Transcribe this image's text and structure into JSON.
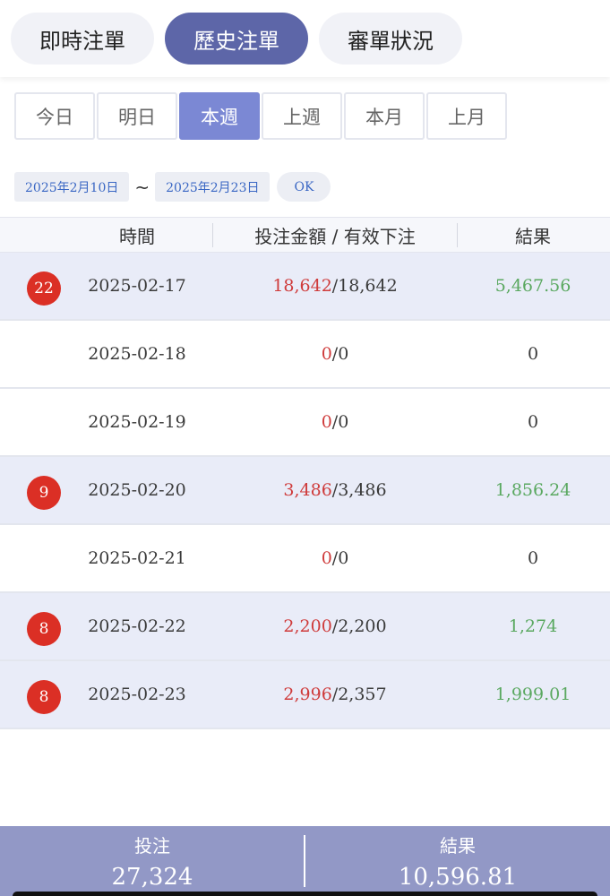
{
  "top_tabs": [
    "即時注單",
    "歷史注單",
    "審單狀況"
  ],
  "active_top_tab": "歷史注單",
  "periods": [
    "今日",
    "明日",
    "本週",
    "上週",
    "本月",
    "上月"
  ],
  "active_period": "本週",
  "date_range": {
    "start": "2025年2月10日",
    "separator": "~",
    "end": "2025年2月23日",
    "ok_label": "OK"
  },
  "table": {
    "headers": {
      "time": "時間",
      "bet": "投注金額 / 有效下注",
      "result": "結果"
    },
    "rows": [
      {
        "count": "22",
        "date": "2025-02-17",
        "bet": "18,642",
        "separator": "/",
        "valid": "18,642",
        "result": "5,467.56"
      },
      {
        "count": "",
        "date": "2025-02-18",
        "bet": "0",
        "separator": "/",
        "valid": "0",
        "result": "0"
      },
      {
        "count": "",
        "date": "2025-02-19",
        "bet": "0",
        "separator": "/",
        "valid": "0",
        "result": "0"
      },
      {
        "count": "9",
        "date": "2025-02-20",
        "bet": "3,486",
        "separator": "/",
        "valid": "3,486",
        "result": "1,856.24"
      },
      {
        "count": "",
        "date": "2025-02-21",
        "bet": "0",
        "separator": "/",
        "valid": "0",
        "result": "0"
      },
      {
        "count": "8",
        "date": "2025-02-22",
        "bet": "2,200",
        "separator": "/",
        "valid": "2,200",
        "result": "1,274"
      },
      {
        "count": "8",
        "date": "2025-02-23",
        "bet": "2,996",
        "separator": "/",
        "valid": "2,357",
        "result": "1,999.01"
      }
    ]
  },
  "summary": {
    "bet_label": "投注",
    "bet_total": "27,324",
    "result_label": "結果",
    "result_total": "10,596.81"
  },
  "colors": {
    "accent": "#5d66a8",
    "period_active": "#7b88d4",
    "bet_red": "#cf3b3b",
    "result_green": "#5aa860",
    "badge_red": "#db2f25",
    "footer": "#9298c6"
  }
}
